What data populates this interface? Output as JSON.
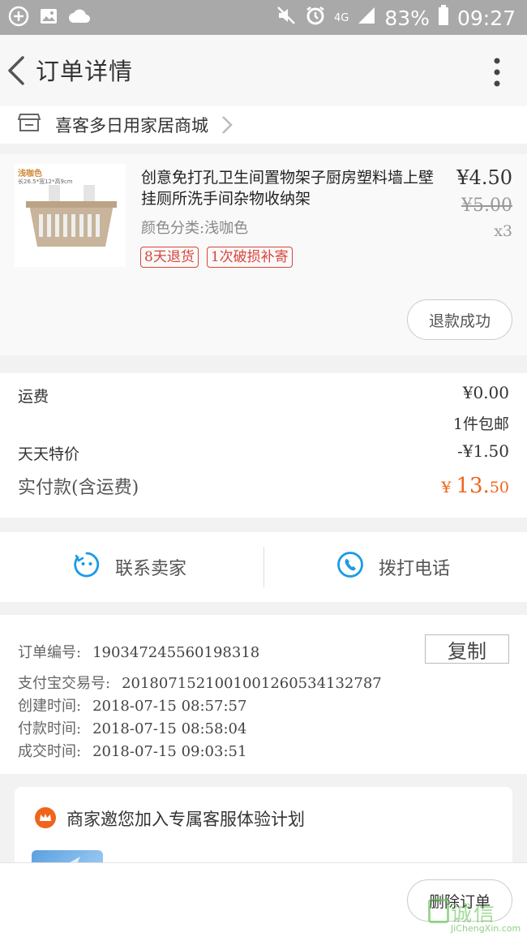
{
  "status_bar": {
    "battery": "83%",
    "time": "09:27",
    "network": "4G",
    "left_icons": [
      "add-circle-icon",
      "image-icon",
      "cloud-icon"
    ],
    "right_icons": [
      "mute-icon",
      "alarm-icon",
      "signal-icon",
      "battery-icon"
    ]
  },
  "header": {
    "title": "订单详情"
  },
  "shop": {
    "name": "喜客多日用家居商城"
  },
  "product": {
    "thumb_label": "浅咖色",
    "thumb_dims": "长26.5*宽12*高9cm",
    "title": "创意免打孔卫生间置物架子厨房塑料墙上壁挂厕所洗手间杂物收纳架",
    "spec": "颜色分类:浅咖色",
    "tags": [
      "8天退货",
      "1次破损补寄"
    ],
    "price": "¥4.50",
    "original_price": "¥5.00",
    "quantity": "x3",
    "refund_status": "退款成功"
  },
  "fees": {
    "shipping_label": "运费",
    "shipping_value": "¥0.00",
    "shipping_note": "1件包邮",
    "discount_label": "天天特价",
    "discount_value": "-¥1.50",
    "total_label": "实付款(含运费)",
    "total_currency": "¥",
    "total_int": "13.",
    "total_dec": "50"
  },
  "contact": {
    "seller_label": "联系卖家",
    "phone_label": "拨打电话"
  },
  "order_info": {
    "order_no_label": "订单编号:",
    "order_no": "190347245560198318",
    "copy_label": "复制",
    "alipay_label": "支付宝交易号:",
    "alipay_no": "2018071521001001260534132787",
    "created_label": "创建时间:",
    "created": "2018-07-15 08:57:57",
    "paid_label": "付款时间:",
    "paid": "2018-07-15 08:58:04",
    "closed_label": "成交时间:",
    "closed": "2018-07-15 09:03:51"
  },
  "service": {
    "text": "商家邀您加入专属客服体验计划"
  },
  "bottom": {
    "delete_label": "删除订单"
  },
  "watermark": {
    "text": "诚信",
    "sub": "JiChengXin.com"
  },
  "colors": {
    "accent": "#f0651b",
    "tag_red": "#d9443a",
    "contact_blue": "#1a9be6"
  }
}
